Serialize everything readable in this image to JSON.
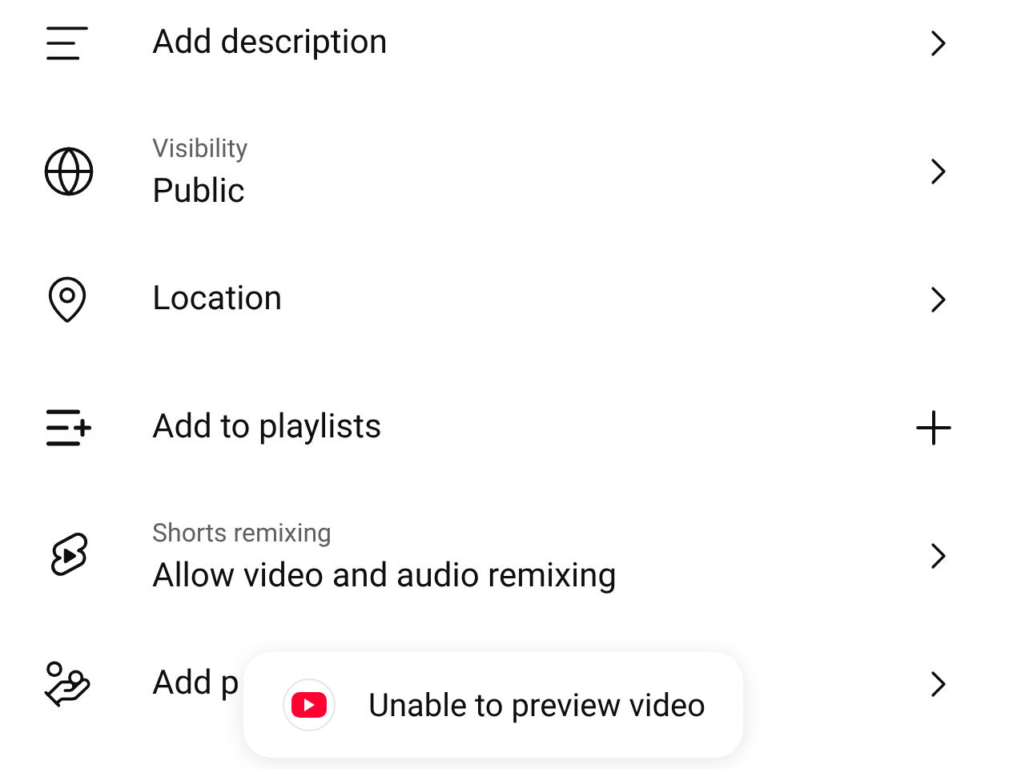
{
  "settings": [
    {
      "kind": "description",
      "label": "Add description",
      "trailing": {
        "kind": "chevron"
      }
    },
    {
      "kind": "visibility",
      "sublabel": "Visibility",
      "label": "Public",
      "trailing": {
        "kind": "chevron"
      }
    },
    {
      "kind": "location",
      "label": "Location",
      "trailing": {
        "kind": "chevron"
      }
    },
    {
      "kind": "playlist",
      "label": "Add to playlists",
      "trailing": {
        "kind": "plus"
      }
    },
    {
      "kind": "remix",
      "sublabel": "Shorts remixing",
      "label": "Allow video and audio remixing",
      "trailing": {
        "kind": "chevron"
      }
    },
    {
      "kind": "promotion",
      "label": "Add p",
      "trailing": {
        "kind": "chevron"
      }
    }
  ],
  "toast": {
    "message": "Unable to preview video"
  }
}
